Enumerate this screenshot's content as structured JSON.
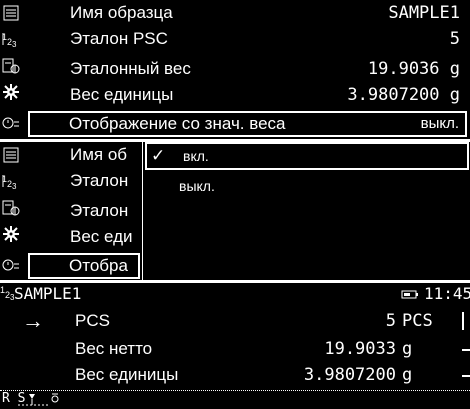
{
  "settings_panel": {
    "rows": [
      {
        "label": "Имя образца",
        "value": "SAMPLE1"
      },
      {
        "label": "Эталон PSC",
        "value": "5"
      },
      {
        "label": "Эталонный вес",
        "value": "19.9036 g"
      },
      {
        "label": "Вес единицы",
        "value": "3.9807200 g"
      },
      {
        "label": "Отображение со знач. веса",
        "value": "выкл."
      }
    ]
  },
  "dropdown_panel": {
    "rows": [
      {
        "label": "Имя об"
      },
      {
        "label": "Эталон"
      },
      {
        "label": "Эталон"
      },
      {
        "label": "Вес еди"
      },
      {
        "label": "Отобра"
      }
    ],
    "options": [
      {
        "label": "вкл.",
        "checked": true
      },
      {
        "label": "выкл.",
        "checked": false
      }
    ],
    "check_mark": "✓"
  },
  "measure_panel": {
    "status": {
      "sample": "SAMPLE1",
      "time": "11:45"
    },
    "rows": [
      {
        "arrow": "→",
        "label": "PCS",
        "value": "5",
        "unit": "PCS"
      },
      {
        "arrow": "",
        "label": "Вес нетто",
        "value": "19.9033",
        "unit": "g"
      },
      {
        "arrow": "",
        "label": "Вес единицы",
        "value": "3.9807200",
        "unit": "g"
      }
    ],
    "bottom_text": "R  S"
  },
  "icons": [
    "list-icon",
    "pcs-icon",
    "balance-icon",
    "gear-icon",
    "display-settings-icon"
  ],
  "colors": {
    "background": "#000000",
    "foreground": "#ffffff"
  }
}
